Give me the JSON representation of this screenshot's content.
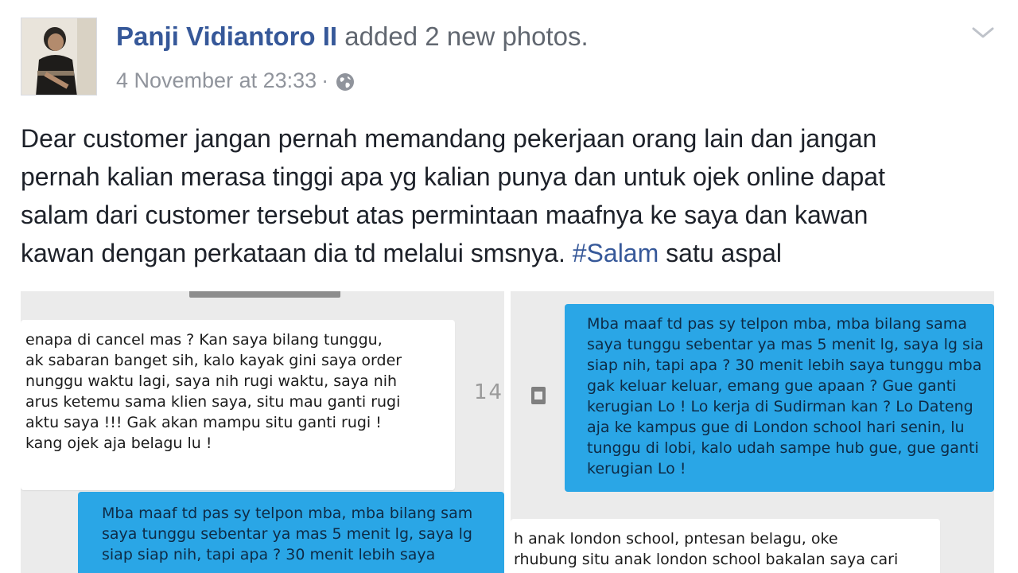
{
  "post": {
    "author_name": "Panji Vidiantoro II",
    "action_text": "added 2 new photos.",
    "timestamp": "4 November at 23:33",
    "meta_separator": "·",
    "text_lines": [
      "Dear customer jangan pernah memandang pekerjaan orang lain dan jangan",
      "pernah kalian merasa tinggi apa yg kalian punya dan untuk ojek online dapat",
      "salam dari customer tersebut atas permintaan maafnya ke saya dan kawan"
    ],
    "last_line_before_tag": "kawan dengan perkataan dia td melalui smsnya. ",
    "hashtag": "#Salam",
    "last_line_after_tag": " satu aspal",
    "icons": {
      "privacy": "globe-icon",
      "options": "chevron-down-icon",
      "avatar": "profile-photo"
    },
    "colors": {
      "link": "#365899",
      "text": "#1d2129",
      "meta": "#90949c",
      "sms_outgoing": "#2aa6e6"
    }
  },
  "photos": {
    "left": {
      "incoming_lines": [
        "enapa di cancel mas ? Kan saya bilang tunggu,",
        "ak sabaran banget sih, kalo kayak gini saya order",
        "nunggu waktu lagi, saya nih rugi waktu, saya nih",
        "arus ketemu sama klien saya, situ mau ganti rugi",
        "aktu saya !!! Gak akan mampu situ ganti rugi !",
        "kang ojek aja belagu lu !"
      ],
      "outgoing_lines": [
        "Mba maaf td pas sy telpon mba, mba bilang sam",
        "saya tunggu sebentar ya mas 5 menit lg, saya lg",
        "siap siap nih, tapi apa ? 30 menit lebih saya"
      ]
    },
    "divider": {
      "count": "14",
      "icon": "document-icon"
    },
    "right": {
      "outgoing_lines": [
        "Mba maaf td pas sy telpon mba, mba bilang sama",
        "saya tunggu sebentar ya mas 5 menit lg, saya lg sia",
        "siap nih, tapi apa ? 30 menit lebih saya tunggu mba",
        "gak keluar keluar, emang gue apaan ? Gue ganti",
        "kerugian Lo ! Lo kerja di Sudirman kan ? Lo Dateng",
        "aja ke kampus gue di London school hari senin, lu",
        "tunggu di lobi, kalo udah sampe hub gue, gue ganti",
        "kerugian Lo !"
      ],
      "incoming_lines": [
        "h anak london school, pntesan belagu, oke",
        "rhubung situ anak london school bakalan saya cari"
      ]
    }
  }
}
